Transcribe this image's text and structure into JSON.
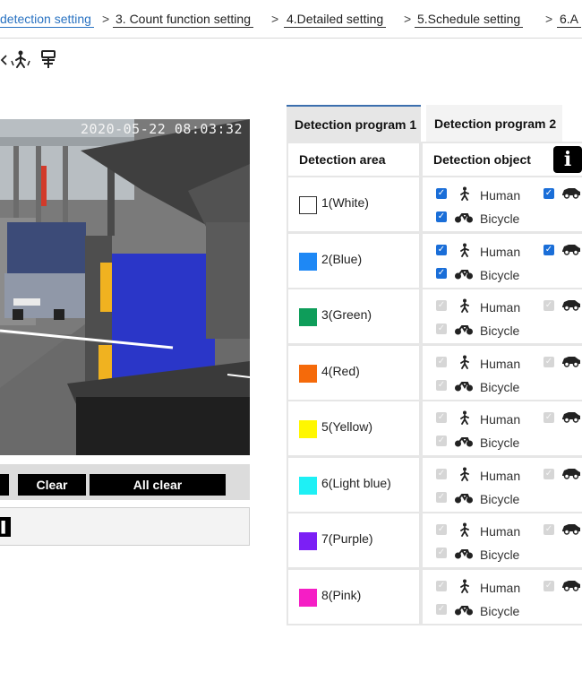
{
  "breadcrumb": {
    "items": [
      {
        "label": "detection setting",
        "active": true
      },
      {
        "label": "3. Count function setting",
        "active": false
      },
      {
        "label": "4.Detailed setting",
        "active": false
      },
      {
        "label": "5.Schedule setting",
        "active": false
      },
      {
        "label": "6.A",
        "active": false
      }
    ],
    "separator": ">"
  },
  "toolbar": {
    "icons": [
      "area-draw-icon",
      "human-detect-icon",
      "vehicle-detect-icon"
    ]
  },
  "camera": {
    "timestamp": "2020-05-22 08:03:32"
  },
  "buttons": {
    "clear": "Clear",
    "all_clear": "All clear"
  },
  "tabs": [
    {
      "label": "Detection program 1",
      "active": true
    },
    {
      "label": "Detection program 2",
      "active": false
    }
  ],
  "table": {
    "headers": {
      "area": "Detection area",
      "object": "Detection object"
    },
    "info_label": "i",
    "object_labels": {
      "human": "Human",
      "bicycle": "Bicycle"
    },
    "rows": [
      {
        "label": "1(White)",
        "color": "#ffffff",
        "enabled": true,
        "human": true,
        "bicycle": true,
        "vehicle": true
      },
      {
        "label": "2(Blue)",
        "color": "#1e88f5",
        "enabled": true,
        "human": true,
        "bicycle": true,
        "vehicle": true
      },
      {
        "label": "3(Green)",
        "color": "#0e9d5a",
        "enabled": false,
        "human": true,
        "bicycle": true,
        "vehicle": true
      },
      {
        "label": "4(Red)",
        "color": "#f56a0a",
        "enabled": false,
        "human": true,
        "bicycle": true,
        "vehicle": true
      },
      {
        "label": "5(Yellow)",
        "color": "#fff700",
        "enabled": false,
        "human": true,
        "bicycle": true,
        "vehicle": true
      },
      {
        "label": "6(Light blue)",
        "color": "#1ef0f5",
        "enabled": false,
        "human": true,
        "bicycle": true,
        "vehicle": true
      },
      {
        "label": "7(Purple)",
        "color": "#7c1ff5",
        "enabled": false,
        "human": true,
        "bicycle": true,
        "vehicle": true
      },
      {
        "label": "8(Pink)",
        "color": "#f51ec5",
        "enabled": false,
        "human": true,
        "bicycle": true,
        "vehicle": true
      }
    ]
  }
}
